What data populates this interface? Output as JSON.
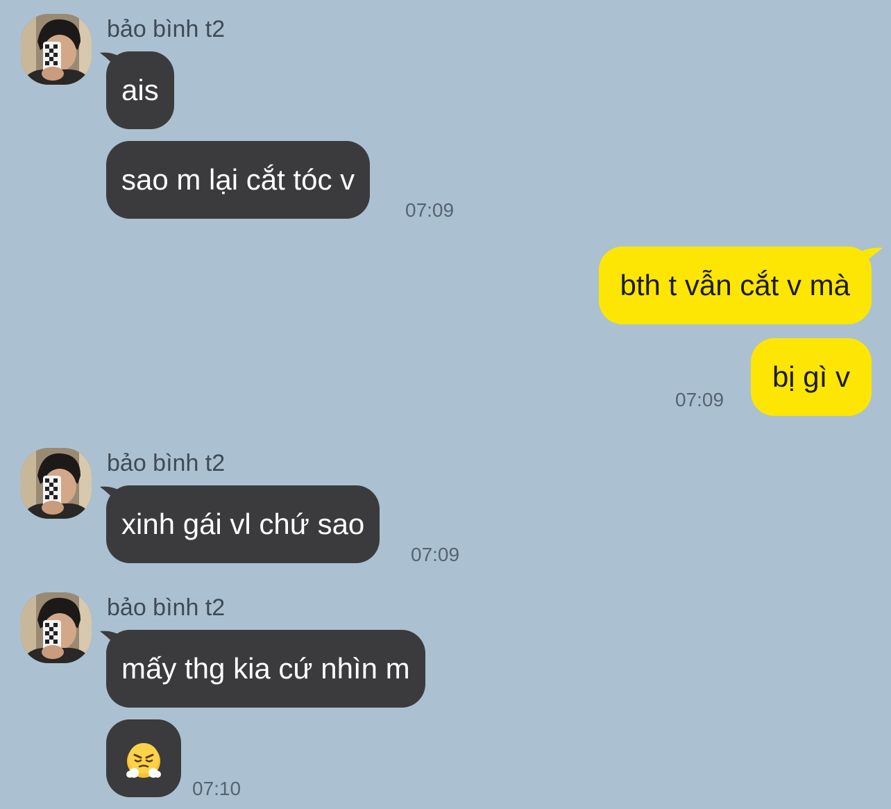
{
  "colors": {
    "background": "#abc1d1",
    "incoming_bubble": "#3b3b3d",
    "outgoing_bubble": "#fde603",
    "incoming_text": "#ffffff",
    "outgoing_text": "#1b1b1b",
    "timestamp": "#566371"
  },
  "groups": [
    {
      "sender": "bảo bình t2",
      "direction": "incoming",
      "messages": [
        {
          "text": "ais"
        },
        {
          "text": "sao m lại cắt tóc v",
          "time": "07:09"
        }
      ]
    },
    {
      "direction": "outgoing",
      "messages": [
        {
          "text": "bth t vẫn cắt v mà"
        },
        {
          "text": "bị gì v",
          "time": "07:09"
        }
      ]
    },
    {
      "sender": "bảo bình t2",
      "direction": "incoming",
      "messages": [
        {
          "text": "xinh gái vl chứ sao",
          "time": "07:09"
        }
      ]
    },
    {
      "sender": "bảo bình t2",
      "direction": "incoming",
      "messages": [
        {
          "text": "mấy thg kia cứ nhìn m"
        },
        {
          "emoji": "face-with-steam-from-nose",
          "time": "07:10"
        }
      ]
    }
  ]
}
